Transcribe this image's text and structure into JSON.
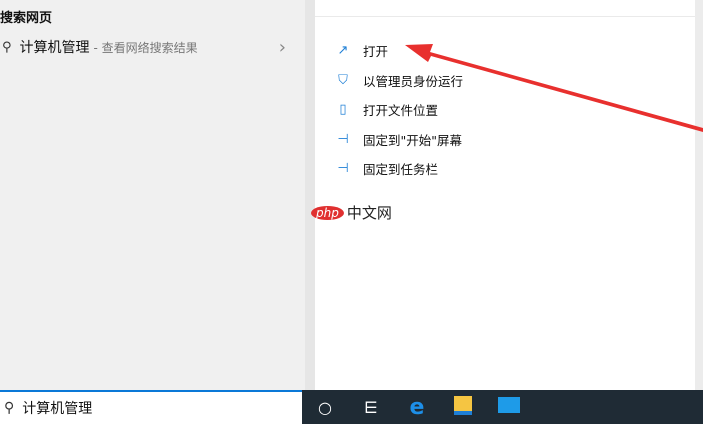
{
  "left": {
    "header": "搜索网页",
    "result": {
      "title": "计算机管理",
      "subtitle": "- 查看网络搜索结果"
    }
  },
  "menu": [
    {
      "icon": "open-icon",
      "glyph": "↗",
      "label": "打开"
    },
    {
      "icon": "admin-shield-icon",
      "glyph": "⛉",
      "label": "以管理员身份运行"
    },
    {
      "icon": "file-location-icon",
      "glyph": "▯",
      "label": "打开文件位置"
    },
    {
      "icon": "pin-icon",
      "glyph": "⊣",
      "label": "固定到\"开始\"屏幕"
    },
    {
      "icon": "pin-icon",
      "glyph": "⊣",
      "label": "固定到任务栏"
    }
  ],
  "search": {
    "value": "计算机管理"
  },
  "watermark": {
    "logo": "php",
    "text": "中文网"
  },
  "colors": {
    "accent": "#0a78d7",
    "arrow": "#e8302e",
    "taskbar": "#1f2b35"
  }
}
